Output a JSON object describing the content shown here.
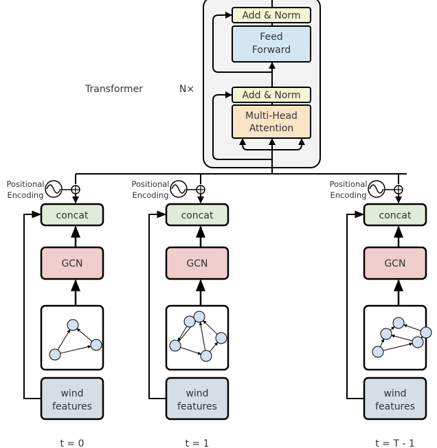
{
  "transformer": {
    "label": "Transformer",
    "repeat": "N×",
    "add_norm_top": "Add & Norm",
    "feed_forward": [
      "Feed",
      "Forward"
    ],
    "add_norm_bottom": "Add & Norm",
    "attention": [
      "Multi-Head",
      "Attention"
    ]
  },
  "columns": [
    {
      "pos_enc": [
        "Positional",
        "Encoding"
      ],
      "concat": "concat",
      "gcn": "GCN",
      "features": [
        "wind",
        "features"
      ],
      "time": "t = 0"
    },
    {
      "pos_enc": [
        "Positional",
        "Encoding"
      ],
      "concat": "concat",
      "gcn": "GCN",
      "features": [
        "wind",
        "features"
      ],
      "time": "t = 1"
    },
    {
      "pos_enc": [
        "Positional",
        "Encoding"
      ],
      "concat": "concat",
      "gcn": "GCN",
      "features": [
        "wind",
        "features"
      ],
      "time": "t = T - 1"
    }
  ],
  "colors": {
    "add_norm": "#f5f5d2",
    "feed_forward": "#d3e7f3",
    "attention": "#fae4c7",
    "concat": "#e0ecd7",
    "gcn": "#efcecd",
    "features": "#d4dee4",
    "node": "#d2e0f1",
    "transformer_bg": "#f3f3f3"
  }
}
